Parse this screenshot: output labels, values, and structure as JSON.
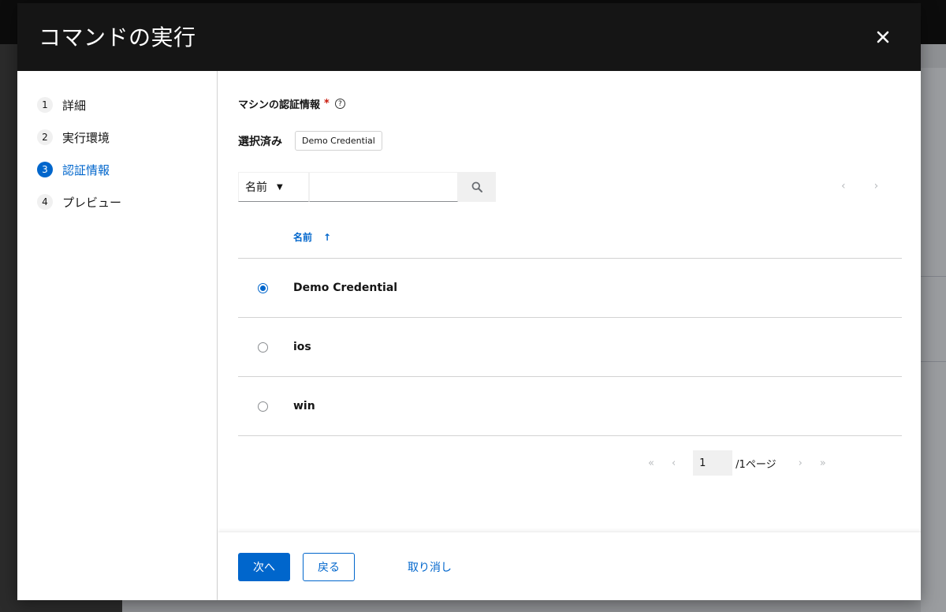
{
  "modal": {
    "title": "コマンドの実行"
  },
  "wizard_nav": {
    "steps": [
      {
        "number": "1",
        "label": "詳細"
      },
      {
        "number": "2",
        "label": "実行環境"
      },
      {
        "number": "3",
        "label": "認証情報"
      },
      {
        "number": "4",
        "label": "プレビュー"
      }
    ],
    "active_step": "3"
  },
  "credential": {
    "field_label": "マシンの認証情報",
    "required_mark": "*",
    "help_glyph": "?",
    "selected_label": "選択済み",
    "selected_chip": "Demo Credential"
  },
  "search": {
    "filter_value": "名前",
    "input_value": "",
    "input_placeholder": ""
  },
  "table": {
    "column_header": "名前",
    "sort_glyph": "↑",
    "rows": [
      {
        "name": "Demo Credential",
        "selected": true
      },
      {
        "name": "ios",
        "selected": false
      },
      {
        "name": "win",
        "selected": false
      }
    ]
  },
  "pagination": {
    "current_page": "1",
    "total_label": "/1ページ",
    "top_prev": "‹",
    "top_next": "›",
    "first": "«",
    "prev": "‹",
    "next": "›",
    "last": "»"
  },
  "footer": {
    "next_label": "次へ",
    "back_label": "戻る",
    "cancel_label": "取り消し"
  },
  "colors": {
    "header_bg": "#151515",
    "accent": "#0066cc",
    "required": "#c9190b"
  }
}
